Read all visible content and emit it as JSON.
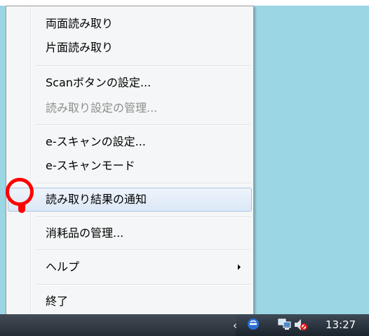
{
  "menu": {
    "items": [
      {
        "label": "両面読み取り"
      },
      {
        "label": "片面読み取り"
      },
      {
        "label": "Scanボタンの設定..."
      },
      {
        "label": "読み取り設定の管理..."
      },
      {
        "label": "e-スキャンの設定..."
      },
      {
        "label": "e-スキャンモード"
      },
      {
        "label": "読み取り結果の通知"
      },
      {
        "label": "消耗品の管理..."
      },
      {
        "label": "ヘルプ"
      },
      {
        "label": "終了"
      }
    ]
  },
  "taskbar": {
    "clock": "13:27",
    "tray_icons": [
      "chevron-left-icon",
      "scanner-icon",
      "network-icon",
      "volume-muted-icon"
    ]
  },
  "colors": {
    "desktop": "#9ad6e4",
    "highlight": "#ff0000",
    "hover_border": "#a8c6e5"
  }
}
